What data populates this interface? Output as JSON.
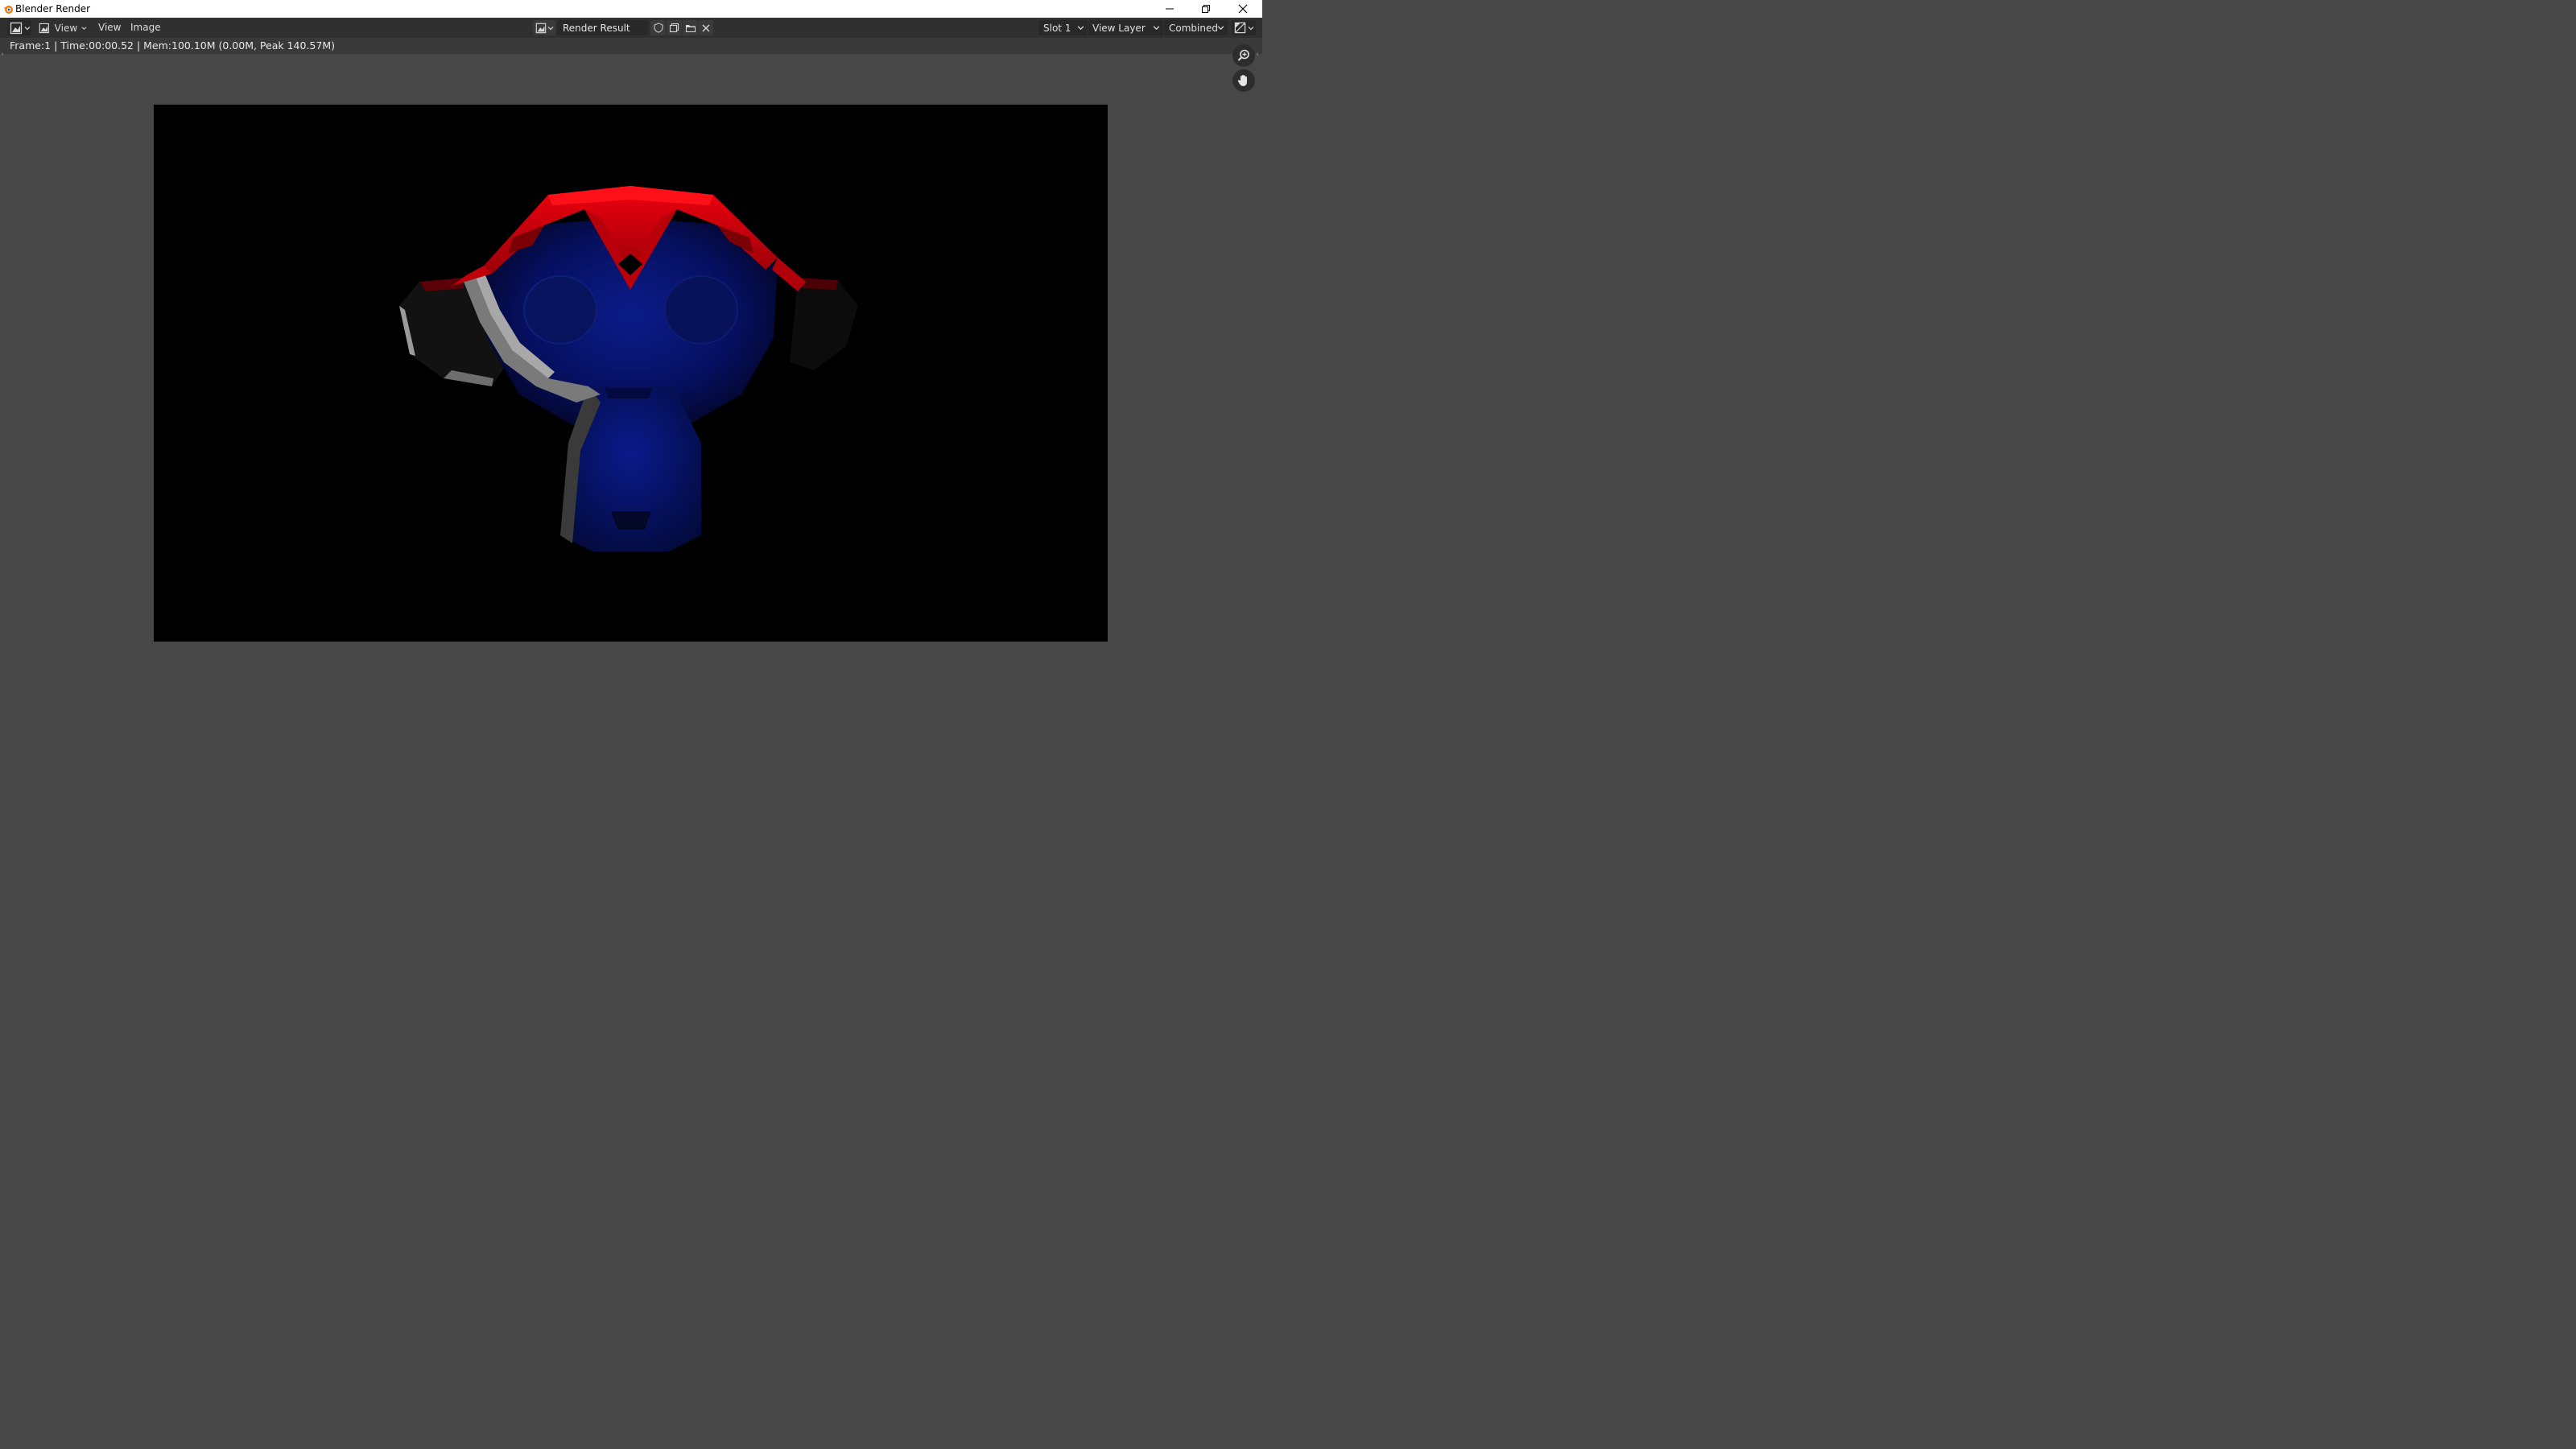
{
  "window": {
    "title": "Blender Render"
  },
  "header": {
    "menus": [
      "View",
      "View",
      "Image"
    ],
    "image_name": "Render Result",
    "slot": "Slot 1",
    "view_layer": "View Layer",
    "pass": "Combined"
  },
  "status": {
    "text": "Frame:1 | Time:00:00.52 | Mem:100.10M (0.00M, Peak 140.57M)"
  },
  "icons": {
    "editor_type": "image-editor-icon",
    "zoom": "zoom-in-icon",
    "pan": "hand-icon"
  },
  "colors": {
    "accent_red": "#e0000a",
    "monkey_blue": "#0a1a80",
    "background": "#474747"
  }
}
